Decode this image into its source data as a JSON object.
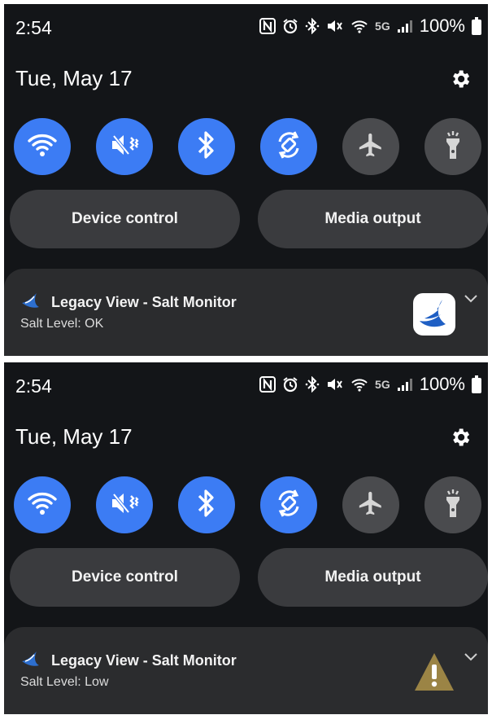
{
  "panels": [
    {
      "status": {
        "time": "2:54",
        "network": "5G",
        "battery": "100%"
      },
      "date": "Tue, May 17",
      "quick_tiles": [
        {
          "icon": "wifi-icon",
          "state": "on"
        },
        {
          "icon": "vibrate-mode-icon",
          "state": "on"
        },
        {
          "icon": "bluetooth-icon",
          "state": "on"
        },
        {
          "icon": "auto-rotate-icon",
          "state": "on"
        },
        {
          "icon": "airplane-mode-icon",
          "state": "off"
        },
        {
          "icon": "flashlight-icon",
          "state": "off"
        }
      ],
      "buttons": {
        "device_control": "Device control",
        "media_output": "Media output"
      },
      "notification": {
        "app_name": "Legacy View - Salt Monitor",
        "text": "Salt Level: OK",
        "icon": "app-logo-icon"
      }
    },
    {
      "status": {
        "time": "2:54",
        "network": "5G",
        "battery": "100%"
      },
      "date": "Tue, May 17",
      "quick_tiles": [
        {
          "icon": "wifi-icon",
          "state": "on"
        },
        {
          "icon": "vibrate-mode-icon",
          "state": "on"
        },
        {
          "icon": "bluetooth-icon",
          "state": "on"
        },
        {
          "icon": "auto-rotate-icon",
          "state": "on"
        },
        {
          "icon": "airplane-mode-icon",
          "state": "off"
        },
        {
          "icon": "flashlight-icon",
          "state": "off"
        }
      ],
      "buttons": {
        "device_control": "Device control",
        "media_output": "Media output"
      },
      "notification": {
        "app_name": "Legacy View - Salt Monitor",
        "text": "Salt Level: Low",
        "icon": "warning-icon"
      }
    }
  ],
  "colors": {
    "panel_bg": "#131518",
    "tile_on": "#3c7cf4",
    "tile_off": "#4a4b4e",
    "pill_bg": "#3a3b3e",
    "notification_bg": "#2b2c2e",
    "warning": "#9b8445"
  }
}
